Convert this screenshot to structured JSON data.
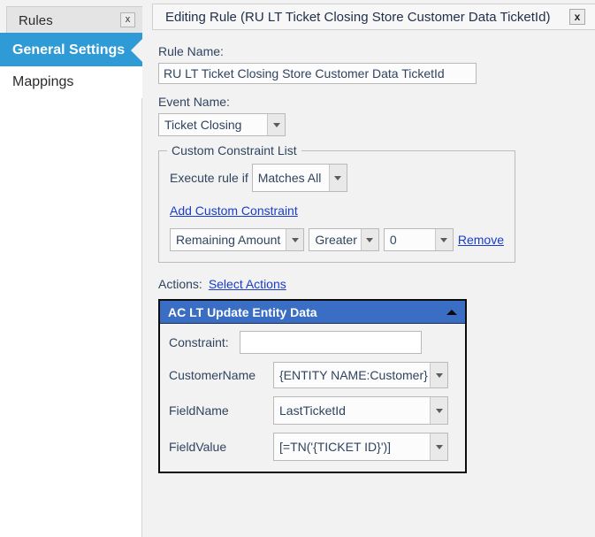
{
  "theme": {
    "accent_blue": "#2e9ad6",
    "panel_header_blue": "#3a6ec4",
    "link_blue": "#1a3cc8",
    "window_gray": "#f2f2f2",
    "label_text": "#30445f"
  },
  "sidebar": {
    "tab": {
      "label": "Rules",
      "close_label": "x"
    },
    "items": [
      {
        "label": "General Settings",
        "active": true
      },
      {
        "label": "Mappings",
        "active": false
      }
    ]
  },
  "window": {
    "title": "Editing Rule (RU LT Ticket Closing Store Customer Data TicketId)",
    "close_label": "x"
  },
  "form": {
    "rule_name": {
      "label": "Rule Name:",
      "value": "RU LT Ticket Closing Store Customer Data TicketId",
      "placeholder": ""
    },
    "event_name": {
      "label": "Event Name:",
      "value": "Ticket Closing"
    }
  },
  "custom_constraint_list": {
    "caption": "Custom Constraint List",
    "execute_rule_if_label": "Execute rule if",
    "execute_rule_if_value": "Matches All",
    "add_link": "Add Custom Constraint",
    "constraints": [
      {
        "field": "Remaining Amount",
        "operator": "Greater",
        "value": "0",
        "remove_label": "Remove"
      }
    ]
  },
  "actions": {
    "label": "Actions:",
    "select_link": "Select Actions",
    "panel": {
      "title": "AC LT Update Entity Data",
      "collapse_icon": "triangle-up-icon",
      "constraint": {
        "label": "Constraint:",
        "value": "",
        "placeholder": ""
      },
      "properties": [
        {
          "label": "CustomerName",
          "value": "{ENTITY NAME:Customer}"
        },
        {
          "label": "FieldName",
          "value": "LastTicketId"
        },
        {
          "label": "FieldValue",
          "value": "[=TN('{TICKET ID}')]"
        }
      ]
    }
  }
}
